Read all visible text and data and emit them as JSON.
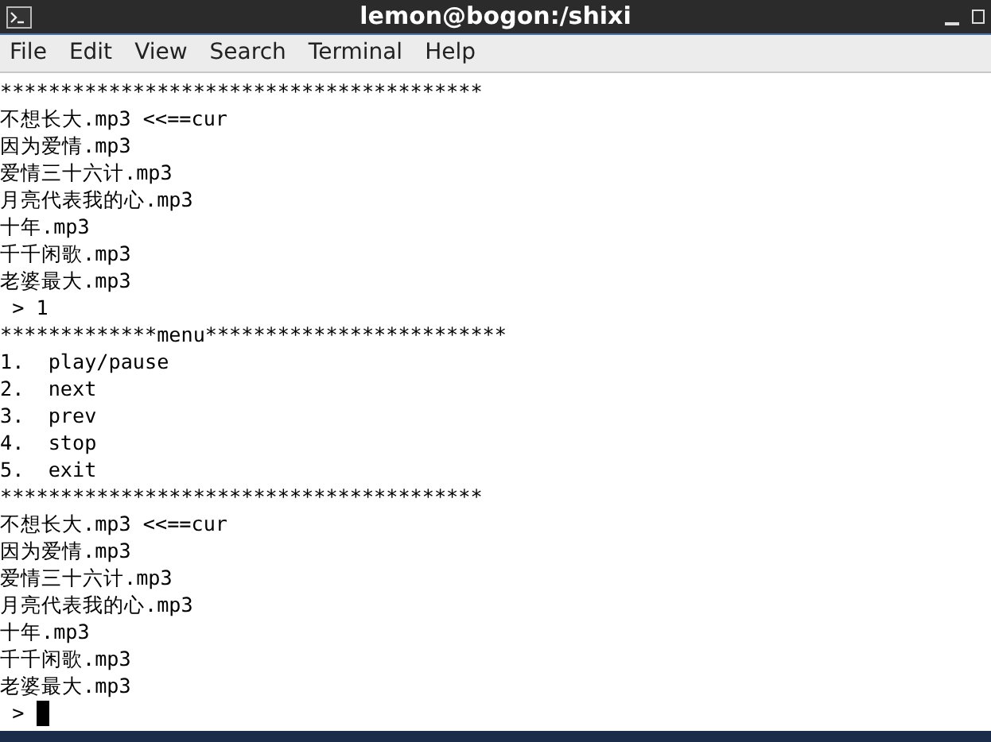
{
  "window": {
    "title": "lemon@bogon:/shixi"
  },
  "menu": [
    "File",
    "Edit",
    "View",
    "Search",
    "Terminal",
    "Help"
  ],
  "terminal": {
    "lines": [
      "****************************************",
      "不想长大.mp3 <<==cur",
      "因为爱情.mp3",
      "爱情三十六计.mp3",
      "月亮代表我的心.mp3",
      "十年.mp3",
      "千千闲歌.mp3",
      "老婆最大.mp3",
      " > 1",
      "*************menu*************************",
      "1.  play/pause",
      "2.  next",
      "3.  prev",
      "4.  stop",
      "5.  exit",
      "****************************************",
      "不想长大.mp3 <<==cur",
      "因为爱情.mp3",
      "爱情三十六计.mp3",
      "月亮代表我的心.mp3",
      "十年.mp3",
      "千千闲歌.mp3",
      "老婆最大.mp3"
    ],
    "prompt": " > "
  }
}
